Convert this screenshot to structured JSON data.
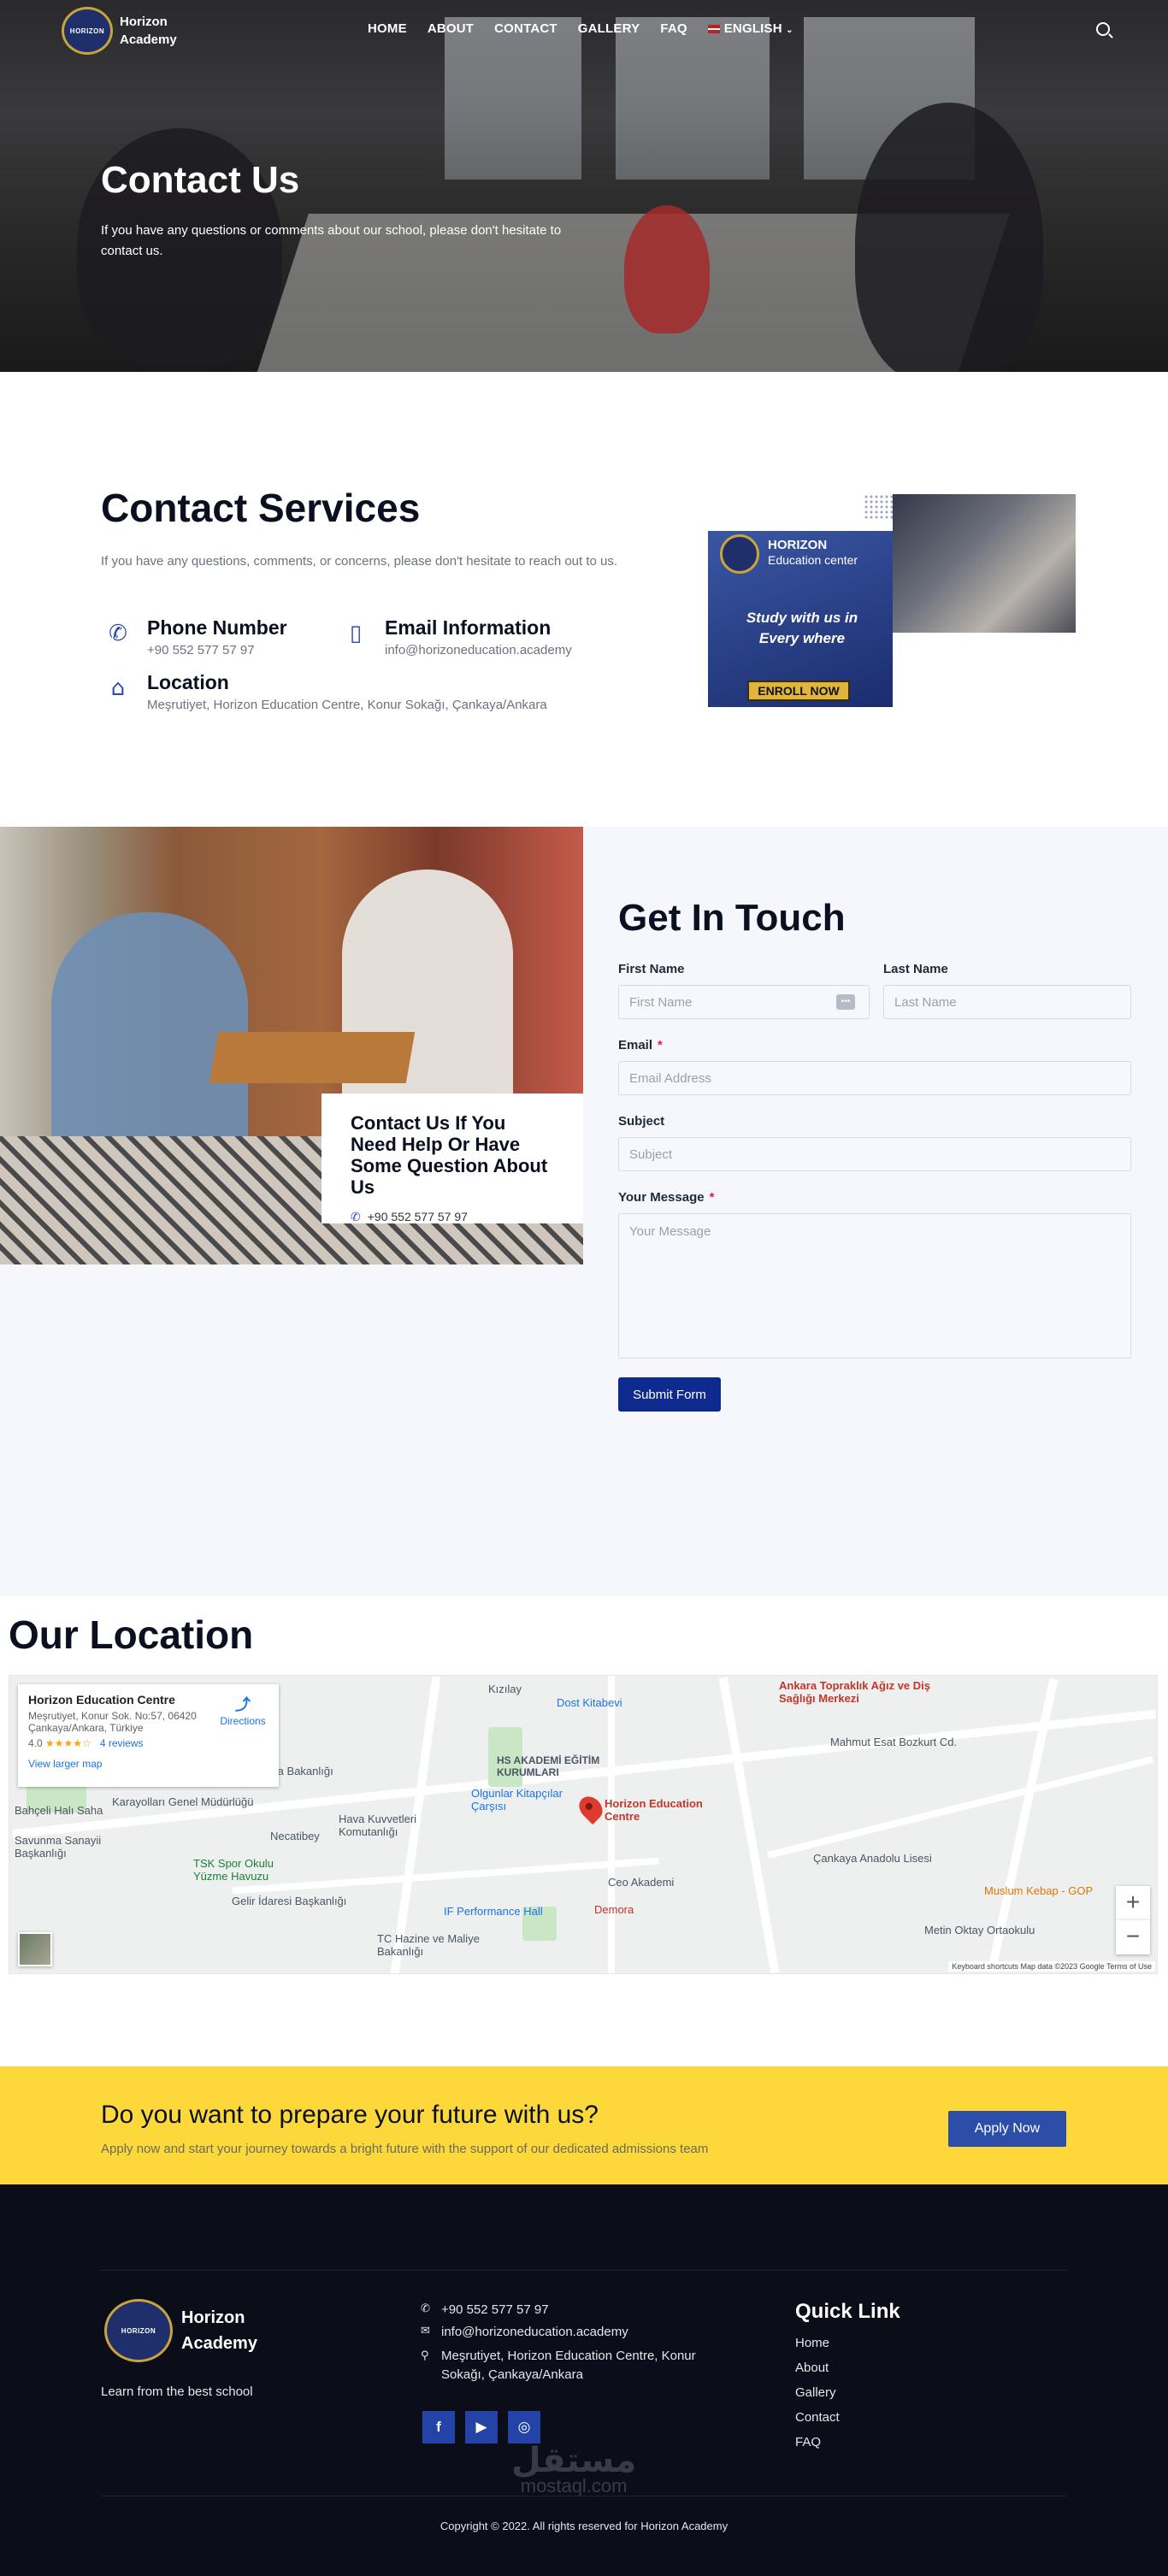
{
  "nav": {
    "logo_line1": "Horizon",
    "logo_line2": "Academy",
    "logo_badge": "HORIZON",
    "items": [
      "HOME",
      "ABOUT",
      "CONTACT",
      "GALLERY",
      "FAQ"
    ],
    "language": "ENGLISH"
  },
  "hero": {
    "title": "Contact Us",
    "subtitle": "If you have any questions or comments about our school, please don't hesitate to contact us."
  },
  "services": {
    "title": "Contact Services",
    "intro": "If you have any questions, comments, or concerns, please don't hesitate to reach out to us.",
    "phone_title": "Phone Number",
    "phone_value": "+90 552 577 57 97",
    "email_title": "Email Information",
    "email_value": "info@horizoneducation.academy",
    "location_title": "Location",
    "location_value": "Meşrutiyet, Horizon Education Centre, Konur Sokağı, Çankaya/Ankara",
    "promo_title": "HORIZON",
    "promo_sub": "Education center",
    "promo_script": "Study with us in Every where",
    "promo_button": "ENROLL NOW"
  },
  "contact_card": {
    "title": "Contact Us If You Need Help Or Have Some Question About Us",
    "phone": "+90 552 577 57 97"
  },
  "form": {
    "title": "Get In Touch",
    "first_label": "First Name",
    "first_placeholder": "First Name",
    "last_label": "Last Name",
    "last_placeholder": "Last Name",
    "email_label": "Email",
    "email_placeholder": "Email Address",
    "subject_label": "Subject",
    "subject_placeholder": "Subject",
    "message_label": "Your Message",
    "message_placeholder": "Your Message",
    "submit": "Submit Form",
    "required_mark": "*"
  },
  "location": {
    "title": "Our Location",
    "place_name": "Horizon Education Centre",
    "address": "Meşrutiyet, Konur Sok. No:57, 06420 Çankaya/Ankara, Türkiye",
    "rating": "4.0",
    "stars": "★★★★☆",
    "reviews": "4 reviews",
    "view_larger": "View larger map",
    "directions": "Directions",
    "pin_label": "Horizon Education Centre",
    "labels": [
      "Kızılay",
      "Dost Kitabevi",
      "HS AKADEMİ EĞİTİM KURUMLARI",
      "Milli Savunma Bakanlığı",
      "Hava Kuvvetleri Komutanlığı",
      "Olgunlar Kitapçılar Çarşısı",
      "TSK Spor Okulu Yüzme Havuzu",
      "Gelir İdaresi Başkanlığı",
      "TC Hazine ve Maliye Bakanlığı",
      "IF Performance Hall",
      "Ceo Akademi",
      "Demora",
      "Mahmut Esat Bozkurt Cd.",
      "Çankaya Anadolu Lisesi",
      "Muslum Kebap - GOP",
      "Metin Oktay Ortaokulu",
      "Ankara Topraklık Ağız ve Diş Sağlığı Merkezi",
      "Karayolları Genel Müdürlüğü",
      "Bahçeli Halı Saha",
      "Savunma Sanayii Başkanlığı",
      "Necatibey"
    ],
    "attribution": "Keyboard shortcuts  Map data ©2023 Google  Terms of Use",
    "zoom_in": "+",
    "zoom_out": "−"
  },
  "cta": {
    "title": "Do you want to prepare your future with us?",
    "subtitle": "Apply now and start your journey towards a bright future with the support of our dedicated admissions team",
    "button": "Apply Now"
  },
  "footer": {
    "logo_line1": "Horizon",
    "logo_line2": "Academy",
    "logo_badge": "HORIZON",
    "tagline": "Learn from the best school",
    "phone": "+90 552 577 57 97",
    "email": "info@horizoneducation.academy",
    "address": "Meşrutiyet, Horizon Education Centre, Konur Sokağı, Çankaya/Ankara",
    "quick_title": "Quick Link",
    "links": [
      "Home",
      "About",
      "Gallery",
      "Contact",
      "FAQ"
    ],
    "watermark_ar": "مستقل",
    "watermark_en": "mostaql.com",
    "copyright": "Copyright © 2022. All rights reserved for Horizon Academy"
  },
  "colors": {
    "accent": "#0f2a8f",
    "cta_bg": "#fcd83b",
    "footer_bg": "#0b0e18",
    "social": "#2343a6"
  }
}
